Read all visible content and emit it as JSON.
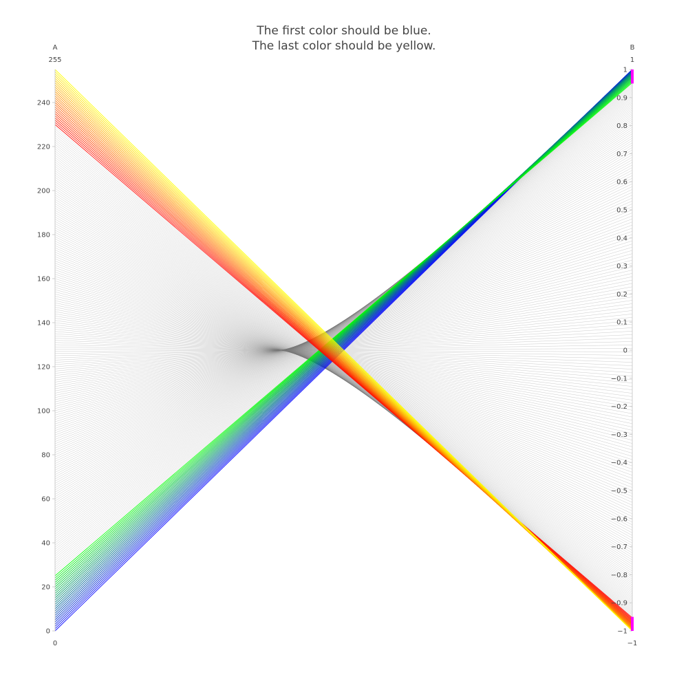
{
  "chart_data": {
    "type": "parallel-coordinates",
    "title_lines": [
      "The first color should be blue.",
      "The last color should be yellow."
    ],
    "dimensions": [
      {
        "label": "A",
        "range": [
          0,
          255
        ],
        "range_labels": {
          "min": "0",
          "max": "255"
        },
        "ticks": [
          0,
          20,
          40,
          60,
          80,
          100,
          120,
          140,
          160,
          180,
          200,
          220,
          240
        ]
      },
      {
        "label": "B",
        "range": [
          -1,
          1
        ],
        "range_labels": {
          "min": "−1",
          "max": "1"
        },
        "ticks": [
          -1,
          -0.9,
          -0.8,
          -0.7,
          -0.6,
          -0.5,
          -0.4,
          -0.3,
          -0.2,
          -0.1,
          0,
          0.1,
          0.2,
          0.3,
          0.4,
          0.5,
          0.6,
          0.7,
          0.8,
          0.9,
          1
        ],
        "tick_labels": [
          "−1",
          "−0.9",
          "−0.8",
          "−0.7",
          "−0.6",
          "−0.5",
          "−0.4",
          "−0.3",
          "−0.2",
          "−0.1",
          "0",
          "0.1",
          "0.2",
          "0.3",
          "0.4",
          "0.5",
          "0.6",
          "0.7",
          "0.8",
          "0.9",
          "1"
        ],
        "constraint_ranges": [
          [
            -1,
            -0.95
          ],
          [
            0.95,
            1
          ]
        ]
      }
    ],
    "data_model": {
      "count": 256,
      "A": "index i from 0 to 255",
      "B": "cos(pi * i / 255) mirrored so that low A maps to high B",
      "selected_B_ranges": [
        [
          -1,
          -0.95
        ],
        [
          0.95,
          1
        ]
      ]
    },
    "colorscale": [
      [
        0.0,
        "#0000ff"
      ],
      [
        0.1,
        "#00ff00"
      ],
      [
        0.9,
        "#ff0000"
      ],
      [
        1.0,
        "#ffff00"
      ]
    ],
    "unselected_color": "#777777",
    "constraint_color": "#ff00ff",
    "axis_color": "#cccccc"
  }
}
